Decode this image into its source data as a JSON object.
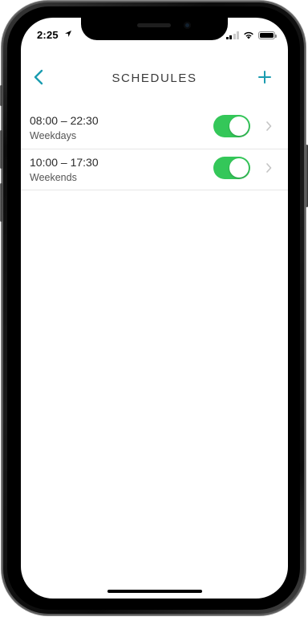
{
  "status_bar": {
    "time": "2:25",
    "location_icon": "location-arrow-icon",
    "signal_icon": "cellular-signal-icon",
    "wifi_icon": "wifi-icon",
    "battery_icon": "battery-icon",
    "battery_level": 1.0
  },
  "nav": {
    "title": "SCHEDULES",
    "back_icon": "chevron-left-icon",
    "add_icon": "plus-icon"
  },
  "schedules": [
    {
      "time_range": "08:00 – 22:30",
      "days": "Weekdays",
      "enabled": true
    },
    {
      "time_range": "10:00 – 17:30",
      "days": "Weekends",
      "enabled": true
    }
  ],
  "colors": {
    "accent": "#1a9cb0",
    "toggle_on": "#34c759",
    "title_text": "#3b3b3b"
  }
}
